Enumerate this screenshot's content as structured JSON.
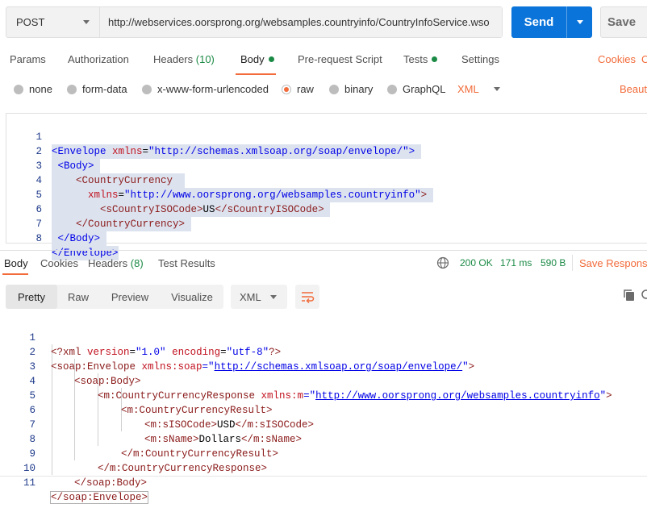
{
  "request": {
    "method": "POST",
    "url": "http://webservices.oorsprong.org/websamples.countryinfo/CountryInfoService.wso",
    "send_label": "Send",
    "save_label": "Save"
  },
  "request_tabs": {
    "params": "Params",
    "authorization": "Authorization",
    "headers": "Headers",
    "headers_count": "(10)",
    "body": "Body",
    "pre_request": "Pre-request Script",
    "tests": "Tests",
    "settings": "Settings",
    "cookies": "Cookies",
    "code_partial": "C"
  },
  "body_types": {
    "none": "none",
    "form_data": "form-data",
    "urlencoded": "x-www-form-urlencoded",
    "raw": "raw",
    "binary": "binary",
    "graphql": "GraphQL",
    "format": "XML",
    "beautify": "Beautif"
  },
  "request_body": {
    "line_numbers": [
      "1",
      "2",
      "3",
      "4",
      "5",
      "6",
      "7",
      "8"
    ],
    "l1_open": "<Envelope ",
    "l1_attr": "xmlns",
    "l1_eq": "=",
    "l1_val": "\"http://schemas.xmlsoap.org/soap/envelope/\"",
    "l1_close": ">",
    "l2": "<Body>",
    "l3": "<CountryCurrency",
    "l4_attr": "xmlns",
    "l4_eq": "=",
    "l4_val": "\"http://www.oorsprong.org/websamples.countryinfo\"",
    "l4_close": ">",
    "l5_open": "<sCountryISOCode>",
    "l5_value": "US",
    "l5_close": "</sCountryISOCode>",
    "l6": "</CountryCurrency>",
    "l7": "</Body>",
    "l8": "</Envelope>"
  },
  "response_tabs": {
    "body": "Body",
    "cookies": "Cookies",
    "headers": "Headers",
    "headers_count": "(8)",
    "test_results": "Test Results",
    "status": "200 OK",
    "time": "171 ms",
    "size": "590 B",
    "save_response": "Save Response"
  },
  "view_modes": {
    "pretty": "Pretty",
    "raw": "Raw",
    "preview": "Preview",
    "visualize": "Visualize",
    "format": "XML"
  },
  "response_body": {
    "line_numbers": [
      "1",
      "2",
      "3",
      "4",
      "5",
      "6",
      "7",
      "8",
      "9",
      "10",
      "11"
    ],
    "l1_a": "<?xml ",
    "l1_b": "version",
    "l1_c": "=",
    "l1_d": "\"1.0\"",
    "l1_e": " ",
    "l1_f": "encoding",
    "l1_g": "=",
    "l1_h": "\"utf-8\"",
    "l1_i": "?>",
    "l2_a": "<soap:Envelope ",
    "l2_b": "xmlns:soap",
    "l2_c": "=\"",
    "l2_d": "http://schemas.xmlsoap.org/soap/envelope/",
    "l2_e": "\"",
    "l2_f": ">",
    "l3": "<soap:Body>",
    "l4_a": "<m:CountryCurrencyResponse ",
    "l4_b": "xmlns:m",
    "l4_c": "=\"",
    "l4_d": "http://www.oorsprong.org/websamples.countryinfo",
    "l4_e": "\"",
    "l4_f": ">",
    "l5": "<m:CountryCurrencyResult>",
    "l6_a": "<m:sISOCode>",
    "l6_b": "USD",
    "l6_c": "</m:sISOCode>",
    "l7_a": "<m:sName>",
    "l7_b": "Dollars",
    "l7_c": "</m:sName>",
    "l8": "</m:CountryCurrencyResult>",
    "l9": "</m:CountryCurrencyResponse>",
    "l10": "</soap:Body>",
    "l11": "</soap:Envelope>"
  },
  "colors": {
    "accent": "#f26b3a",
    "send": "#0a74da",
    "status_ok": "#1b8a45"
  },
  "icons": [
    "caret-down-icon",
    "globe-icon",
    "wrap-lines-icon",
    "copy-icon",
    "search-icon"
  ]
}
